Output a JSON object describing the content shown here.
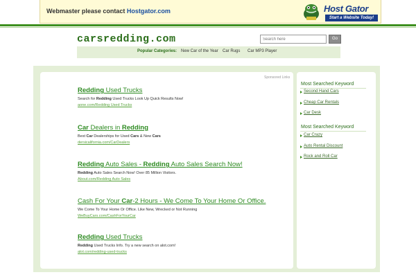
{
  "banner": {
    "text": "Webmaster please contact ",
    "link": "Hostgator.com",
    "logo_name": "Host Gator",
    "logo_tagline": "Start a Website Today!"
  },
  "site": {
    "logo": "carsredding.com"
  },
  "search": {
    "placeholder": "Search here",
    "button": "Go"
  },
  "categories": {
    "label": "Popular Categories:",
    "items": [
      "New Car of the Year",
      "Car Rugs",
      "Car MP3 Player"
    ]
  },
  "main": {
    "sponsored_label": "Sponsored Links",
    "ads": [
      {
        "title_parts": [
          [
            "Redding",
            true
          ],
          [
            " Used Trucks",
            false
          ]
        ],
        "desc_parts": [
          [
            "Search for ",
            false
          ],
          [
            "Redding",
            true
          ],
          [
            " Used Trucks Look Up Quick Results Now!",
            false
          ]
        ],
        "url": "aone.com/Redding Used Trucks"
      },
      {
        "title_parts": [
          [
            "Car",
            true
          ],
          [
            " Dealers in ",
            false
          ],
          [
            "Redding",
            true
          ]
        ],
        "desc_parts": [
          [
            "Best ",
            false
          ],
          [
            "Car",
            true
          ],
          [
            " Dealerships for Used ",
            false
          ],
          [
            "Cars",
            true
          ],
          [
            " & New ",
            false
          ],
          [
            "Cars",
            true
          ]
        ],
        "url": "dersicalifornia.com/CarDealers"
      },
      {
        "title_parts": [
          [
            "Redding",
            true
          ],
          [
            " Auto Sales - ",
            false
          ],
          [
            "Redding",
            true
          ],
          [
            " Auto Sales Search Now!",
            false
          ]
        ],
        "desc_parts": [
          [
            "Redding",
            true
          ],
          [
            " Auto Sales Search Now! Over 85 Million Visitors.",
            false
          ]
        ],
        "url": "About.com/Redding Auto Sales"
      },
      {
        "title_parts": [
          [
            "Cash For Your ",
            false
          ],
          [
            "Car",
            true
          ],
          [
            "-2 Hours - We Come To Your Home Or Office.",
            false
          ]
        ],
        "desc_parts": [
          [
            "We Come To Your Home Or Office. Like New, Wrecked or Not Running",
            false
          ]
        ],
        "url": "WeBuyCars.com/CashForYourCar"
      },
      {
        "title_parts": [
          [
            "Redding",
            true
          ],
          [
            " Used Trucks",
            false
          ]
        ],
        "desc_parts": [
          [
            "Redding",
            true
          ],
          [
            " Used Trucks Info. Try a new search on alot.com!",
            false
          ]
        ],
        "url": "alot.com/redding-used-trucks"
      }
    ]
  },
  "sidebar": {
    "groups": [
      {
        "heading": "Most Searched Keyword",
        "links": [
          "Second Hand Cars",
          "Cheap Car Rentals",
          "Car Desk"
        ]
      },
      {
        "heading": "Most Searched Keyword",
        "links": [
          "Car Crazy",
          "Auto Rental Discount",
          "Rock and Roll Car"
        ]
      }
    ]
  },
  "colors": {
    "accent_green": "#2e8b22",
    "banner_bg": "#fffbd6",
    "frame_bg": "#e4efd7",
    "link_blue": "#1a4fa0"
  }
}
